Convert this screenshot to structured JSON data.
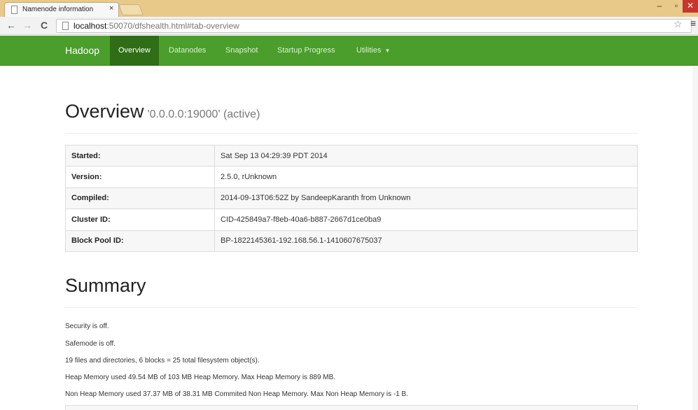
{
  "browser": {
    "tab_title": "Namenode information",
    "tab_close": "×",
    "url_host": "localhost",
    "url_rest": ":50070/dfshealth.html#tab-overview"
  },
  "navbar": {
    "brand": "Hadoop",
    "items": [
      {
        "label": "Overview",
        "active": true
      },
      {
        "label": "Datanodes"
      },
      {
        "label": "Snapshot"
      },
      {
        "label": "Startup Progress"
      },
      {
        "label": "Utilities",
        "dropdown": true
      }
    ]
  },
  "overview": {
    "title": "Overview",
    "subtitle": "'0.0.0.0:19000' (active)",
    "rows": [
      {
        "key": "Started:",
        "value": "Sat Sep 13 04:29:39 PDT 2014"
      },
      {
        "key": "Version:",
        "value": "2.5.0, rUnknown"
      },
      {
        "key": "Compiled:",
        "value": "2014-09-13T06:52Z by SandeepKaranth from Unknown"
      },
      {
        "key": "Cluster ID:",
        "value": "CID-425849a7-f8eb-40a6-b887-2667d1ce0ba9"
      },
      {
        "key": "Block Pool ID:",
        "value": "BP-1822145361-192.168.56.1-1410607675037"
      }
    ]
  },
  "summary": {
    "title": "Summary",
    "lines": [
      "Security is off.",
      "Safemode is off.",
      "19 files and directories, 6 blocks = 25 total filesystem object(s).",
      "Heap Memory used 49.54 MB of 103 MB Heap Memory. Max Heap Memory is 889 MB.",
      "Non Heap Memory used 37.37 MB of 38.31 MB Commited Non Heap Memory. Max Non Heap Memory is -1 B."
    ]
  },
  "colors": {
    "navbar_bg": "#4b9e2b",
    "navbar_active": "#2f6e17"
  }
}
